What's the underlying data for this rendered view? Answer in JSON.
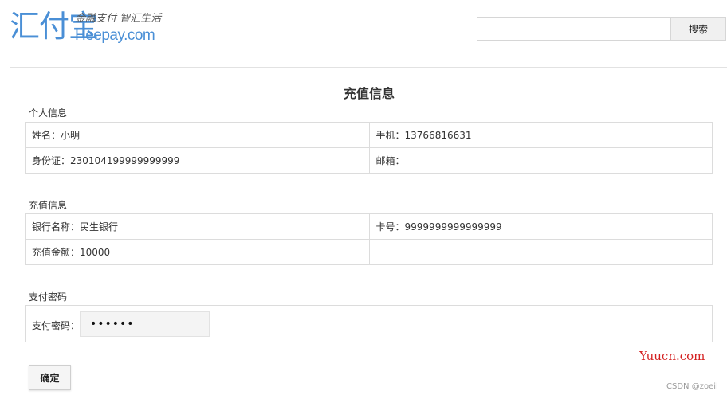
{
  "header": {
    "logo_main": "汇付宝",
    "logo_slogan": "金融支付 智汇生活",
    "logo_domain": "Heepay.com",
    "search": {
      "value": "",
      "placeholder": "",
      "button_label": "搜索"
    }
  },
  "page_title": "充值信息",
  "personal": {
    "section_label": "个人信息",
    "name": {
      "label": "姓名：",
      "value": "小明"
    },
    "phone": {
      "label": "手机：",
      "value": "13766816631"
    },
    "id_card": {
      "label": "身份证：",
      "value": "230104199999999999"
    },
    "email": {
      "label": "邮箱：",
      "value": ""
    }
  },
  "recharge": {
    "section_label": "充值信息",
    "bank_name": {
      "label": "银行名称：",
      "value": "民生银行"
    },
    "card_no": {
      "label": "卡号：",
      "value": "9999999999999999"
    },
    "amount": {
      "label": "充值金额：",
      "value": "10000"
    }
  },
  "payment": {
    "section_label": "支付密码",
    "password_label": "支付密码：",
    "password_mask": "••••••"
  },
  "confirm_label": "确定",
  "watermark": {
    "site": "Yuucn.com",
    "credit": "CSDN @zoeil"
  },
  "colors": {
    "logo_blue": "#4a8fd6",
    "watermark_red": "#d42020"
  }
}
